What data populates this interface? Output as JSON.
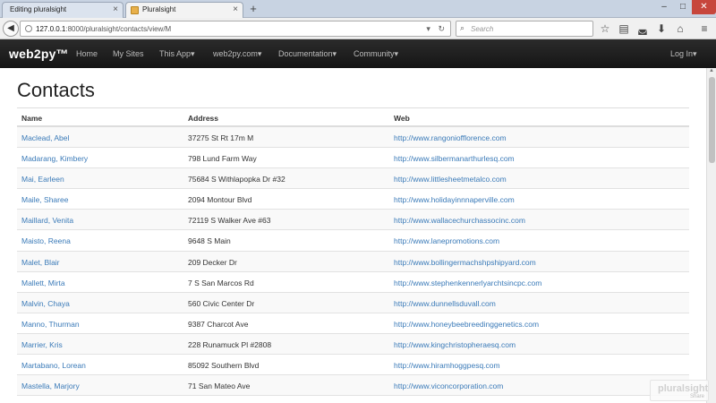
{
  "browser": {
    "tabs": [
      {
        "title": "Editing pluralsight",
        "active": false
      },
      {
        "title": "Pluralsight",
        "active": true
      }
    ],
    "new_tab_icon": "+",
    "url_host": "127.0.0.1",
    "url_rest": ":8000/pluralsight/contacts/view/M",
    "search_placeholder": "Search",
    "icons": [
      "back-icon",
      "reload-icon",
      "search-icon",
      "star-icon",
      "reading-list-icon",
      "pocket-icon",
      "download-icon",
      "home-icon",
      "menu-icon"
    ]
  },
  "app_nav": {
    "brand": "web2py™",
    "items": [
      {
        "label": "Home"
      },
      {
        "label": "My Sites"
      },
      {
        "label": "This App"
      },
      {
        "label": "web2py.com"
      },
      {
        "label": "Documentation"
      },
      {
        "label": "Community"
      }
    ],
    "login": "Log In"
  },
  "page": {
    "title": "Contacts",
    "columns": [
      "Name",
      "Address",
      "Web"
    ],
    "rows": [
      {
        "name": "Maclead, Abel",
        "address": "37275 St Rt 17m M",
        "web": "http://www.rangoniofflorence.com"
      },
      {
        "name": "Madarang, Kimbery",
        "address": "798 Lund Farm Way",
        "web": "http://www.silbermanarthurlesq.com"
      },
      {
        "name": "Mai, Earleen",
        "address": "75684 S Withlapopka Dr #32",
        "web": "http://www.littlesheetmetalco.com"
      },
      {
        "name": "Maile, Sharee",
        "address": "2094 Montour Blvd",
        "web": "http://www.holidayinnnaperville.com"
      },
      {
        "name": "Maillard, Venita",
        "address": "72119 S Walker Ave #63",
        "web": "http://www.wallacechurchassocinc.com"
      },
      {
        "name": "Maisto, Reena",
        "address": "9648 S Main",
        "web": "http://www.lanepromotions.com"
      },
      {
        "name": "Malet, Blair",
        "address": "209 Decker Dr",
        "web": "http://www.bollingermachshpshipyard.com"
      },
      {
        "name": "Mallett, Mirta",
        "address": "7 S San Marcos Rd",
        "web": "http://www.stephenkennerlyarchtsincpc.com"
      },
      {
        "name": "Malvin, Chaya",
        "address": "560 Civic Center Dr",
        "web": "http://www.dunnellsduvall.com"
      },
      {
        "name": "Manno, Thurman",
        "address": "9387 Charcot Ave",
        "web": "http://www.honeybeebreedinggenetics.com"
      },
      {
        "name": "Marrier, Kris",
        "address": "228 Runamuck Pl #2808",
        "web": "http://www.kingchristopheraesq.com"
      },
      {
        "name": "Martabano, Lorean",
        "address": "85092 Southern Blvd",
        "web": "http://www.hiramhoggpesq.com"
      },
      {
        "name": "Mastella, Marjory",
        "address": "71 San Mateo Ave",
        "web": "http://www.viconcorporation.com"
      }
    ]
  },
  "watermark": {
    "logo": "pluralsight",
    "sub": "Share"
  }
}
